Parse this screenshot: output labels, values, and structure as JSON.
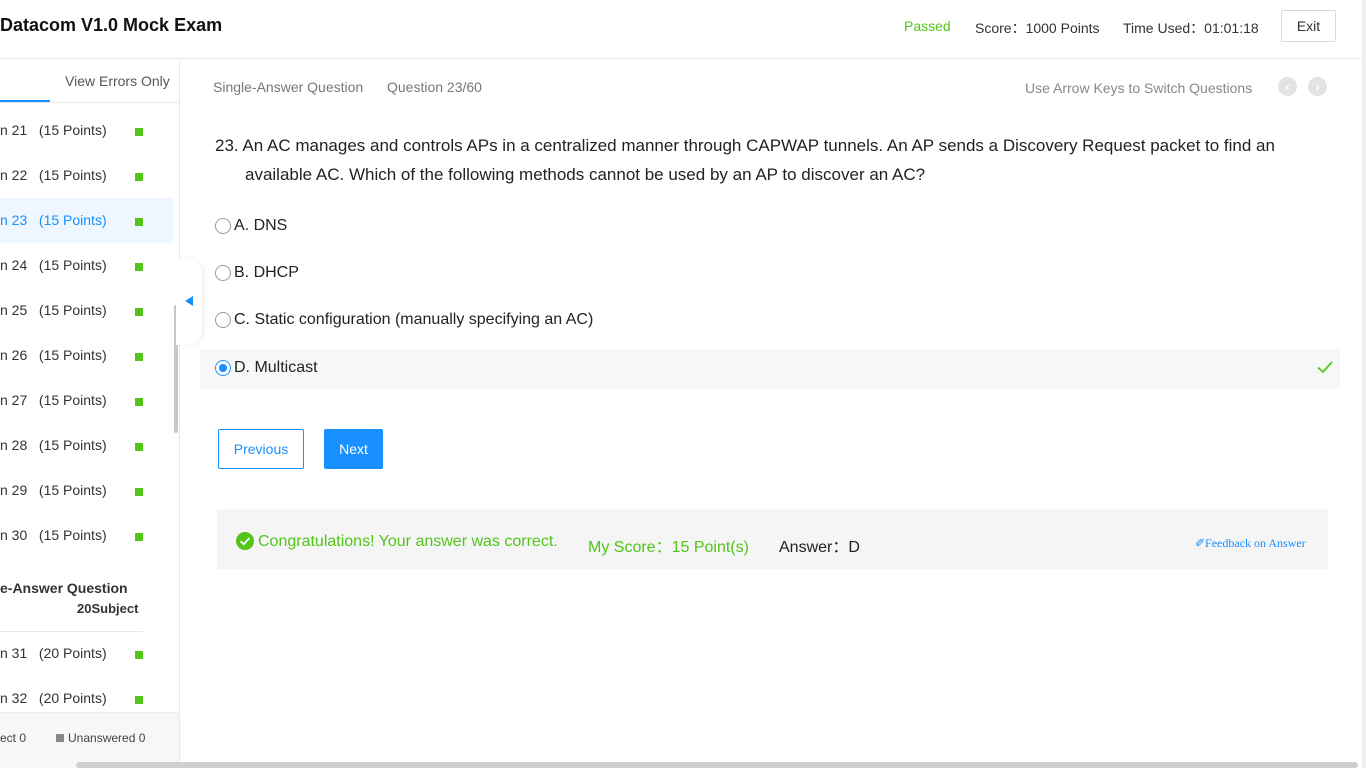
{
  "header": {
    "exam_title": "Datacom V1.0 Mock Exam",
    "status": "Passed",
    "score_label": "Score：1000 Points",
    "time_label": "Time Used：01:01:18",
    "exit_label": "Exit"
  },
  "sidebar": {
    "view_errors_label": "View Errors Only",
    "items_group1": [
      {
        "label": "n 21   (15 Points)"
      },
      {
        "label": "n 22   (15 Points)"
      },
      {
        "label": "n 23   (15 Points)",
        "active": true
      },
      {
        "label": "n 24   (15 Points)"
      },
      {
        "label": "n 25   (15 Points)"
      },
      {
        "label": "n 26   (15 Points)"
      },
      {
        "label": "n 27   (15 Points)"
      },
      {
        "label": "n 28   (15 Points)"
      },
      {
        "label": "n 29   (15 Points)"
      },
      {
        "label": "n 30   (15 Points)"
      }
    ],
    "section_title": "e-Answer Question",
    "section_count": "20Subject",
    "items_group2": [
      {
        "label": "n 31   (20 Points)"
      },
      {
        "label": "n 32   (20 Points)"
      }
    ],
    "footer_correct": "ect 0",
    "footer_unanswered": "Unanswered 0",
    "status_color": "#52c41a"
  },
  "main": {
    "question_type": "Single-Answer Question",
    "question_number": "Question 23/60",
    "arrow_hint": "Use Arrow Keys to Switch Questions",
    "prev_icon": "‹",
    "next_icon": "›",
    "question_text": "23. An AC manages and controls APs in a centralized manner through CAPWAP tunnels. An AP sends a Discovery Request packet to find an available AC. Which of the following methods cannot be used by an AP to discover an AC?",
    "options": [
      {
        "label": "A. DNS"
      },
      {
        "label": "B. DHCP"
      },
      {
        "label": "C. Static configuration (manually specifying an AC)"
      },
      {
        "label": "D. Multicast",
        "selected": true
      }
    ],
    "previous_label": "Previous",
    "next_label": "Next",
    "result": {
      "congrats": "Congratulations! Your answer was correct.",
      "my_score": "My Score：15 Point(s)",
      "answer": "Answer：D",
      "feedback": "✐Feedback on Answer"
    },
    "accent_color": "#1890ff",
    "success_color": "#52c41a"
  }
}
